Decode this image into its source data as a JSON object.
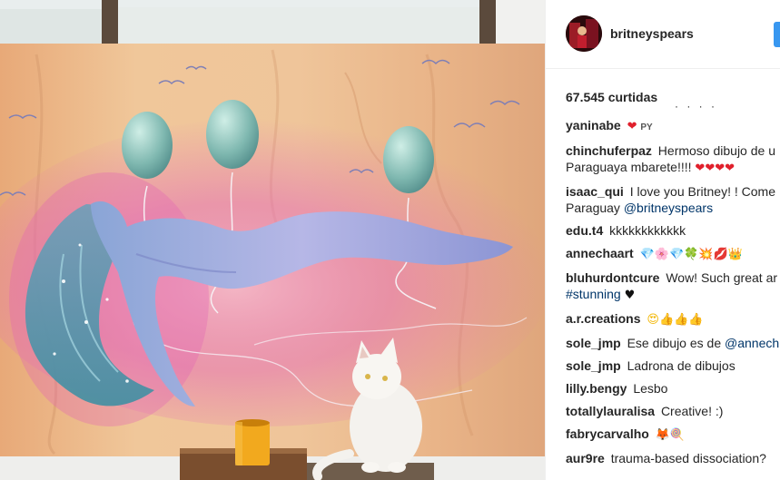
{
  "post": {
    "username": "britneyspears",
    "likes": "67.545 curtidas",
    "photo_alt": "",
    "follow_color": "#3897f0"
  },
  "comments": [
    {
      "user": "yaninabe",
      "text": "",
      "emoji": "❤",
      "suffix": "PY"
    },
    {
      "user": "chinchuferpaz",
      "text": "Hermoso dibujo de u",
      "line2": "Paraguaya mbarete!!!! ",
      "emoji": "❤❤❤❤"
    },
    {
      "user": "isaac_qui",
      "text": "I love you Britney! ! Come",
      "line2": "Paraguay ",
      "tag": "@britneyspears"
    },
    {
      "user": "edu.t4",
      "text": "kkkkkkkkkkkk"
    },
    {
      "user": "annechaart",
      "text": "",
      "emoji": "💎🌸💎🍀💥💋👑"
    },
    {
      "user": "bluhurdontcure",
      "text": "Wow! Such great ar",
      "line2_tag": "#stunning",
      "line2_emoji": "♥"
    },
    {
      "user": "a.r.creations",
      "text": "",
      "emoji": "😍👍👍👍"
    },
    {
      "user": "sole_jmp",
      "text": "Ese dibujo es de ",
      "tag": "@annech"
    },
    {
      "user": "sole_jmp",
      "text": "Ladrona de dibujos"
    },
    {
      "user": "lilly.bengy",
      "text": "Lesbo"
    },
    {
      "user": "totallylauralisa",
      "text": "Creative! :)"
    },
    {
      "user": "fabrycarvalho",
      "text": "",
      "emoji": "🦊🍭"
    },
    {
      "user": "aur9re",
      "text": "trauma-based dissociation?"
    }
  ]
}
